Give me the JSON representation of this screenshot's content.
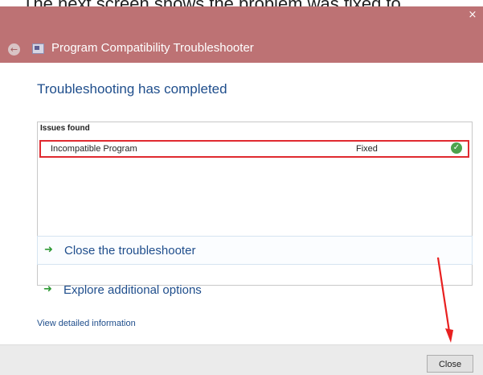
{
  "caption": "The next screen shows the problem was fixed to",
  "window": {
    "title": "Program Compatibility Troubleshooter",
    "close_glyph": "×"
  },
  "main": {
    "heading": "Troubleshooting has completed",
    "issues": {
      "header": "Issues found",
      "rows": [
        {
          "name": "Incompatible Program",
          "status": "Fixed",
          "status_icon": "check-icon"
        }
      ]
    },
    "options": [
      {
        "label": "Close the troubleshooter",
        "icon": "green-arrow-icon"
      },
      {
        "label": "Explore additional options",
        "icon": "green-arrow-icon"
      }
    ],
    "detail_link": "View detailed information"
  },
  "footer": {
    "close_label": "Close"
  },
  "colors": {
    "titlebar": "#bd7274",
    "link_blue": "#1f4e8c",
    "highlight_red": "#e02a30",
    "arrow_green": "#2f9a36"
  }
}
